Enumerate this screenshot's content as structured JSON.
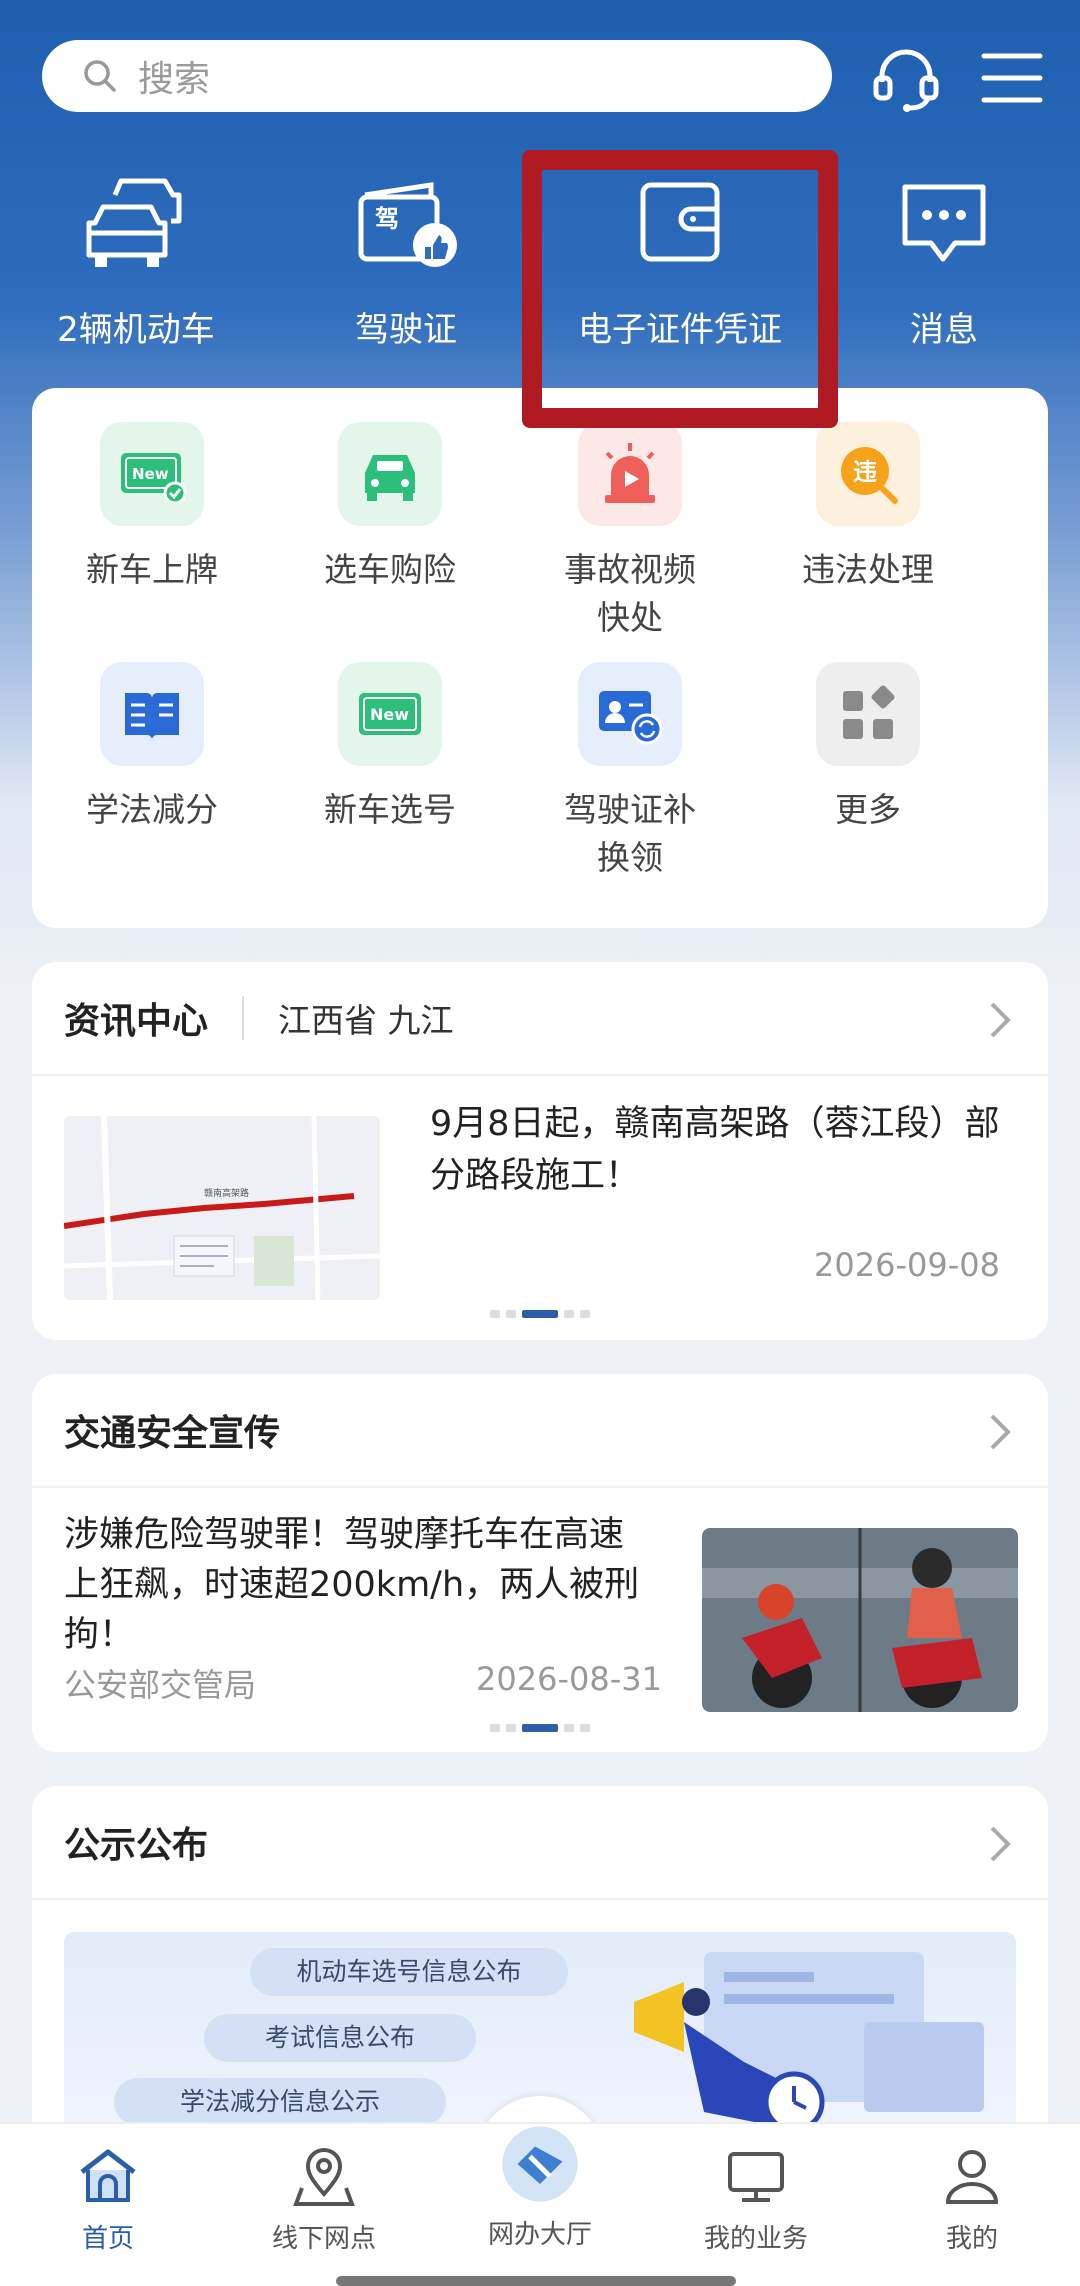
{
  "search": {
    "placeholder": "搜索",
    "icon": "search-icon"
  },
  "header_icons": {
    "support": "headset-icon",
    "menu": "menu-icon"
  },
  "quick_entries": [
    {
      "label": "2辆机动车",
      "icon": "cars-icon"
    },
    {
      "label": "驾驶证",
      "icon": "license-icon"
    },
    {
      "label": "电子证件凭证",
      "icon": "wallet-icon",
      "highlighted": true
    },
    {
      "label": "消息",
      "icon": "message-icon"
    }
  ],
  "highlight_color": "#b01a22",
  "services": [
    {
      "label": "新车上牌",
      "icon": "new-plate-icon",
      "bg": "#e4f6ec"
    },
    {
      "label": "选车购险",
      "icon": "car-insurance-icon",
      "bg": "#e4f6ec"
    },
    {
      "label": "事故视频快处",
      "icon": "alarm-video-icon",
      "bg": "#fde8e8"
    },
    {
      "label": "违法处理",
      "icon": "violation-icon",
      "bg": "#fdf1dd"
    },
    {
      "label": "学法减分",
      "icon": "book-icon",
      "bg": "#e6eefc"
    },
    {
      "label": "新车选号",
      "icon": "new-number-icon",
      "bg": "#e4f6ec"
    },
    {
      "label": "驾驶证补换领",
      "icon": "license-replace-icon",
      "bg": "#e6eefc"
    },
    {
      "label": "更多",
      "icon": "more-grid-icon",
      "bg": "#eeeeee"
    }
  ],
  "news": {
    "title": "资讯中心",
    "region": "江西省 九江",
    "headline": "9月8日起，赣南高架路（蓉江段）部分路段施工！",
    "date": "2026-09-08",
    "map_caption": "赣南高架路"
  },
  "safety": {
    "title": "交通安全宣传",
    "headline": "涉嫌危险驾驶罪！驾驶摩托车在高速上狂飙，时速超200km/h，两人被刑拘！",
    "source": "公安部交管局",
    "date": "2026-08-31"
  },
  "notice": {
    "title": "公示公布",
    "pills": [
      "机动车选号信息公布",
      "考试信息公布",
      "学法减分信息公示"
    ]
  },
  "nav": [
    {
      "label": "首页",
      "icon": "home-icon",
      "active": true
    },
    {
      "label": "线下网点",
      "icon": "location-icon"
    },
    {
      "label": "网办大厅",
      "icon": "hall-icon"
    },
    {
      "label": "我的业务",
      "icon": "monitor-icon"
    },
    {
      "label": "我的",
      "icon": "user-icon"
    }
  ],
  "accent_color": "#2a5ea8"
}
